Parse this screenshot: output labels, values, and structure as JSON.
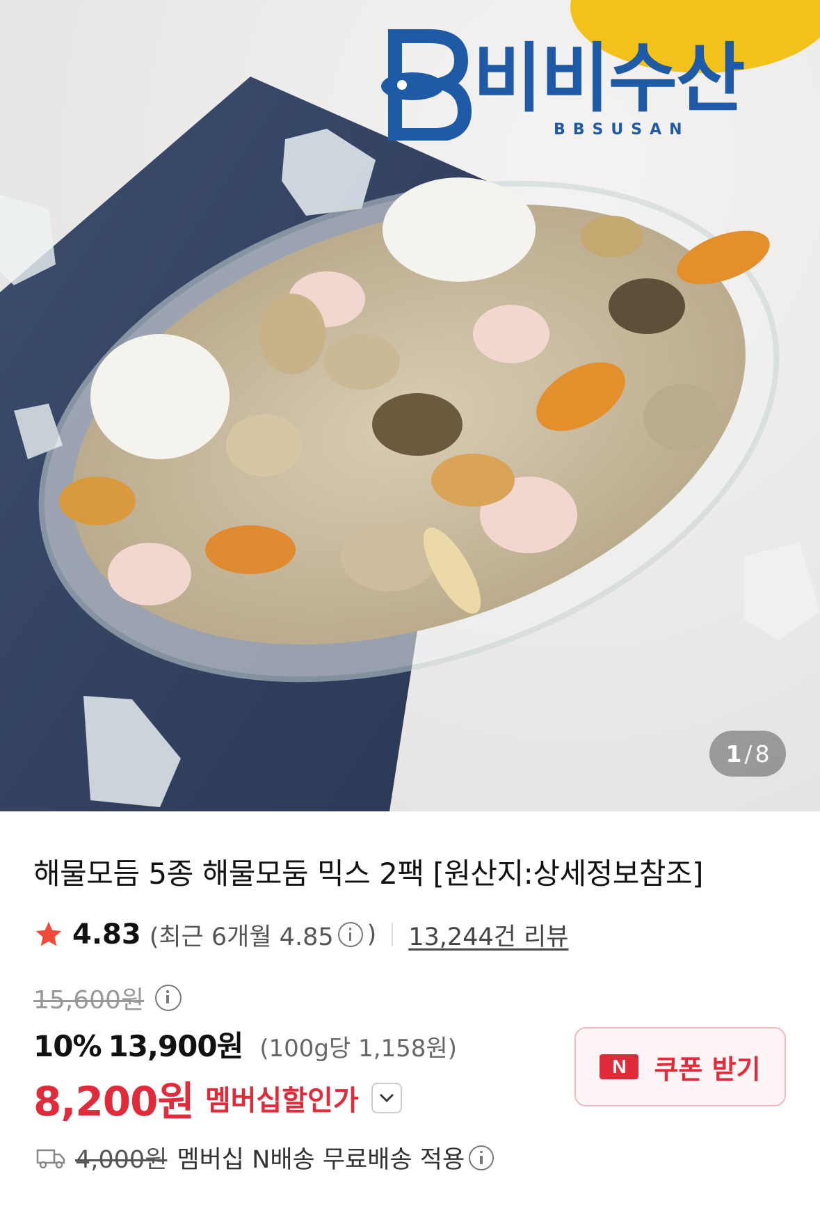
{
  "hero": {
    "logo_text": "비비수산",
    "logo_subtext": "BBSUSAN",
    "image_index": "1",
    "image_separator": "/",
    "image_total": "8"
  },
  "product": {
    "title": "해물모듬 5종 해물모둠 믹스 2팩 [원산지:상세정보참조]",
    "rating": "4.83",
    "recent_prefix": "(최근 6개월 4.85",
    "recent_suffix": ")",
    "review_count": "13,244건 리뷰",
    "original_price": "15,600원",
    "discount_rate": "10%",
    "sale_price": "13,900원",
    "unit_price": "(100g당 1,158원)",
    "member_price": "8,200원",
    "member_label": "멤버십할인가",
    "coupon_badge": "N",
    "coupon_label": "쿠폰 받기",
    "shipping_original": "4,000원",
    "shipping_text": "멤버십 N배송 무료배송 적용"
  },
  "colors": {
    "accent_red": "#e02b3a",
    "logo_blue": "#1f5aa6",
    "star": "#ef4a3a"
  }
}
